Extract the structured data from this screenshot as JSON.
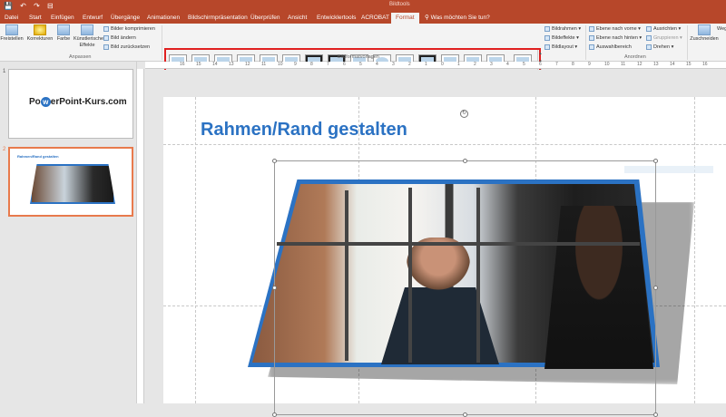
{
  "titlebar": {
    "qat_icons": "💾 ↶ ↷ ⊟",
    "context_label": "Bildtools"
  },
  "tabs": [
    {
      "label": "Datei"
    },
    {
      "label": "Start"
    },
    {
      "label": "Einfügen"
    },
    {
      "label": "Entwurf"
    },
    {
      "label": "Übergänge"
    },
    {
      "label": "Animationen"
    },
    {
      "label": "Bildschirmpräsentation"
    },
    {
      "label": "Überprüfen"
    },
    {
      "label": "Ansicht"
    },
    {
      "label": "Entwicklertools"
    },
    {
      "label": "ACROBAT"
    },
    {
      "label": "Format"
    },
    {
      "label": "Was möchten Sie tun?"
    }
  ],
  "ribbon": {
    "freistellen": "Freistellen",
    "korrekturen": "Korrekturen",
    "farbe": "Farbe",
    "kuenstlerische": "Künstlerische Effekte",
    "bilder_komprimieren": "Bilder komprimieren",
    "bild_aendern": "Bild ändern",
    "bild_zuruecksetzen": "Bild zurücksetzen",
    "group_anpassen": "Anpassen",
    "group_bildformatvorlagen": "Bildformatvorlagen",
    "bildrahmen": "Bildrahmen",
    "bildeffekte": "Bildeffekte",
    "bildlayout": "Bildlayout",
    "ebene_vorne": "Ebene nach vorne",
    "ebene_hinten": "Ebene nach hinten",
    "auswahlbereich": "Auswahlbereich",
    "ausrichten": "Ausrichten",
    "gruppieren": "Gruppieren",
    "drehen": "Drehen",
    "group_anordnen": "Anordnen",
    "zuschneiden": "Zuschneiden",
    "weg": "Weg"
  },
  "ruler": {
    "ticks": [
      "16",
      "15",
      "14",
      "13",
      "12",
      "11",
      "10",
      "9",
      "8",
      "7",
      "6",
      "5",
      "4",
      "3",
      "2",
      "1",
      "0",
      "1",
      "2",
      "3",
      "4",
      "5",
      "6",
      "7",
      "8",
      "9",
      "10",
      "11",
      "12",
      "13",
      "14",
      "15",
      "16"
    ]
  },
  "slides_panel": {
    "slide1_num": "1",
    "slide1_logo_a": "Po",
    "slide1_logo_o": "w",
    "slide1_logo_b": "erPoint-Kurs.com",
    "slide2_num": "2",
    "slide2_title": "Rahmen/Rand gestalten"
  },
  "slide": {
    "title": "Rahmen/Rand gestalten"
  },
  "colors": {
    "accent": "#b7472a",
    "title_blue": "#2b72c3",
    "highlight": "#e02020"
  }
}
